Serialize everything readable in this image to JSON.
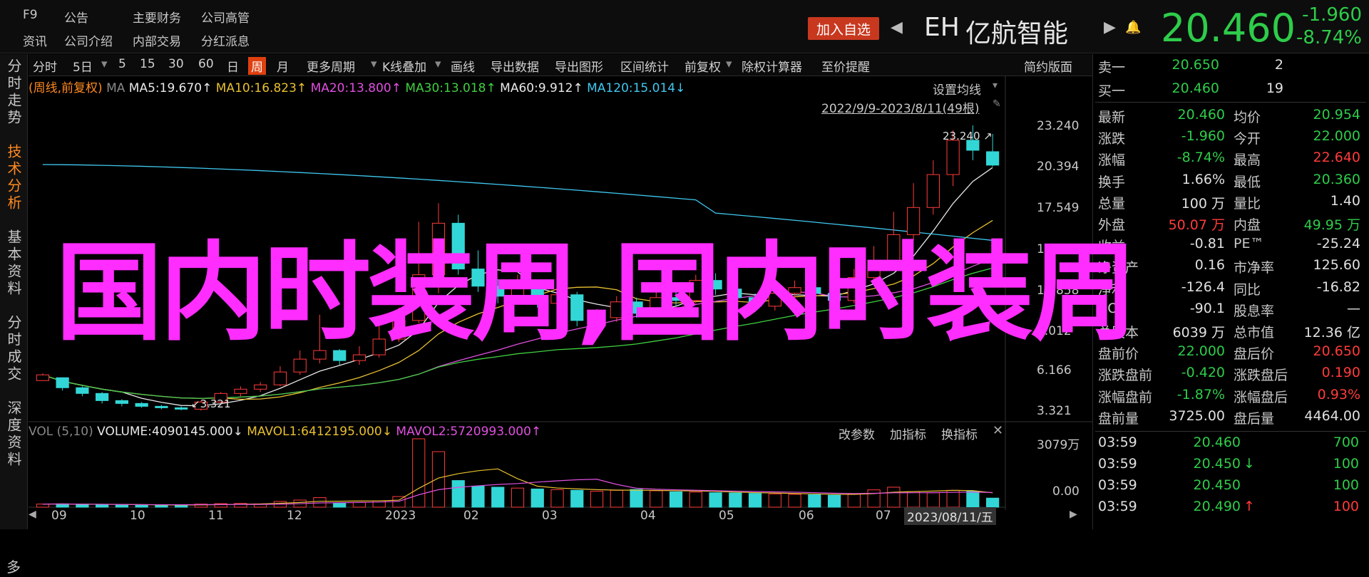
{
  "topmenu": {
    "row1": [
      "F9",
      "公告",
      "主要财务",
      "公司高管"
    ],
    "row2": [
      "资讯",
      "公司介绍",
      "内部交易",
      "分红派息"
    ]
  },
  "header": {
    "add_watch": "加入自选",
    "symbol": "EH",
    "name": "亿航智能",
    "price": "20.460",
    "change": "-1.960",
    "change_pct": "-8.74%"
  },
  "left_tabs": [
    "分时走势",
    "技术分析",
    "基本资料",
    "分时成交",
    "深度资料",
    "多"
  ],
  "toolbar": {
    "items": [
      "分时",
      "5日",
      "5",
      "15",
      "30",
      "60",
      "日",
      "周",
      "月",
      "更多周期",
      "K线叠加",
      "画线",
      "导出数据",
      "导出图形",
      "区间统计",
      "前复权",
      "除权计算器",
      "至价提醒"
    ],
    "right": "简约版面"
  },
  "ma_legend": {
    "label": "(周线,前复权)",
    "ma": "MA",
    "ma5": "MA5:19.670↑",
    "ma10": "MA10:16.823↑",
    "ma20": "MA20:13.800↑",
    "ma30": "MA30:13.018↑",
    "ma60": "MA60:9.912↑",
    "ma120": "MA120:15.014↓"
  },
  "chart_header": {
    "setting": "设置均线",
    "range": "2022/9/9-2023/8/11(49根)"
  },
  "price_axis": [
    "23.240",
    "20.394",
    "17.549",
    "14.703",
    "11.858",
    "9.012",
    "6.166",
    "3.321"
  ],
  "annotations": {
    "high": "23.240",
    "low": "3.321"
  },
  "vol_legend": {
    "vol": "VOL (5,10)",
    "volume": "VOLUME:4090145.000↓",
    "mavol1": "MAVOL1:6412195.000↓",
    "mavol2": "MAVOL2:5720993.000↑",
    "btns": [
      "改参数",
      "加指标",
      "换指标"
    ]
  },
  "vol_axis": [
    "3079万",
    "0.00"
  ],
  "x_axis": [
    "09",
    "10",
    "11",
    "12",
    "2023",
    "02",
    "03",
    "04",
    "05",
    "06",
    "07"
  ],
  "date_label": "2023/08/11/五",
  "overlay_text": "国内时装周,国内时装周",
  "order_book": [
    {
      "label": "卖一",
      "price": "20.650",
      "vol": "2"
    },
    {
      "label": "买一",
      "price": "20.460",
      "vol": "19"
    }
  ],
  "quote_rows": [
    {
      "l1": "最新",
      "v1": "20.460",
      "c1": "g",
      "l2": "均价",
      "v2": "20.954",
      "c2": "g"
    },
    {
      "l1": "涨跌",
      "v1": "-1.960",
      "c1": "g",
      "l2": "今开",
      "v2": "22.000",
      "c2": "g"
    },
    {
      "l1": "涨幅",
      "v1": "-8.74%",
      "c1": "g",
      "l2": "最高",
      "v2": "22.640",
      "c2": "red"
    },
    {
      "l1": "换手",
      "v1": "1.66%",
      "c1": "w",
      "l2": "最低",
      "v2": "20.360",
      "c2": "g"
    },
    {
      "l1": "总量",
      "v1": "100 万",
      "c1": "w",
      "l2": "量比",
      "v2": "1.40",
      "c2": "w"
    },
    {
      "l1": "外盘",
      "v1": "50.07 万",
      "c1": "red",
      "l2": "内盘",
      "v2": "49.95 万",
      "c2": "g"
    },
    {
      "l1": "收益",
      "v1": "-0.81",
      "c1": "w",
      "l2": "PE™",
      "v2": "-25.24",
      "c2": "w"
    },
    {
      "l1": "净资产",
      "v1": "0.16",
      "c1": "w",
      "l2": "市净率",
      "v2": "125.60",
      "c2": "w"
    },
    {
      "l1": "净利",
      "v1": "-126.4",
      "c1": "w",
      "l2": "同比",
      "v2": "-16.82",
      "c2": "w"
    },
    {
      "l1": "ROE",
      "v1": "-90.1",
      "c1": "w",
      "l2": "股息率",
      "v2": "—",
      "c2": "w"
    },
    {
      "l1": "总股本",
      "v1": "6039 万",
      "c1": "w",
      "l2": "总市值",
      "v2": "12.36 亿",
      "c2": "w"
    },
    {
      "l1": "盘前价",
      "v1": "22.000",
      "c1": "g",
      "l2": "盘后价",
      "v2": "20.650",
      "c2": "red"
    },
    {
      "l1": "涨跌盘前",
      "v1": "-0.420",
      "c1": "g",
      "l2": "涨跌盘后",
      "v2": "0.190",
      "c2": "red"
    },
    {
      "l1": "涨幅盘前",
      "v1": "-1.87%",
      "c1": "g",
      "l2": "涨幅盘后",
      "v2": "0.93%",
      "c2": "red"
    },
    {
      "l1": "盘前量",
      "v1": "3725.00",
      "c1": "w",
      "l2": "盘后量",
      "v2": "4464.00",
      "c2": "w"
    }
  ],
  "ticks": [
    {
      "t": "03:59",
      "p": "20.460",
      "arrow": "",
      "v": "700",
      "vc": "g"
    },
    {
      "t": "03:59",
      "p": "20.450",
      "arrow": "↓",
      "v": "100",
      "vc": "g"
    },
    {
      "t": "03:59",
      "p": "20.450",
      "arrow": "",
      "v": "100",
      "vc": "g"
    },
    {
      "t": "03:59",
      "p": "20.490",
      "arrow": "↑",
      "v": "100",
      "vc": "red"
    }
  ],
  "colors": {
    "up": "#ff3b3b",
    "down": "#2ecc4a",
    "cyan": "#33d6d6",
    "ma5": "#e8e8e8",
    "ma10": "#e8c030",
    "ma20": "#e050e0",
    "ma30": "#40d040",
    "ma60": "#e8e8e8",
    "ma120": "#40c8f0",
    "overlay": "#ff2dff"
  },
  "chart_data": {
    "type": "candlestick",
    "price_range": [
      3.321,
      23.24
    ],
    "candles": [
      [
        5.4,
        5.8,
        5.6,
        5.9
      ],
      [
        5.6,
        4.9,
        5.6,
        4.7
      ],
      [
        4.9,
        4.5,
        5.0,
        4.3
      ],
      [
        4.5,
        4.0,
        4.6,
        3.8
      ],
      [
        4.0,
        3.8,
        4.1,
        3.6
      ],
      [
        3.8,
        3.6,
        3.9,
        3.5
      ],
      [
        3.6,
        3.5,
        3.7,
        3.4
      ],
      [
        3.5,
        3.4,
        3.6,
        3.32
      ],
      [
        3.4,
        3.9,
        4.0,
        3.3
      ],
      [
        3.9,
        4.5,
        4.6,
        3.8
      ],
      [
        4.5,
        4.8,
        5.0,
        4.3
      ],
      [
        4.8,
        5.1,
        5.3,
        4.6
      ],
      [
        5.1,
        6.0,
        6.4,
        5.0
      ],
      [
        6.0,
        6.9,
        7.5,
        5.8
      ],
      [
        6.9,
        7.5,
        10.0,
        6.6
      ],
      [
        7.5,
        6.8,
        7.6,
        6.5
      ],
      [
        6.8,
        7.2,
        7.8,
        6.5
      ],
      [
        7.2,
        8.3,
        9.5,
        7.0
      ],
      [
        8.3,
        9.6,
        10.5,
        8.1
      ],
      [
        9.6,
        12.8,
        16.5,
        9.4
      ],
      [
        12.8,
        16.4,
        17.8,
        11.5
      ],
      [
        16.4,
        13.2,
        17.0,
        12.8
      ],
      [
        13.2,
        12.0,
        14.5,
        11.6
      ],
      [
        12.0,
        11.3,
        12.5,
        10.8
      ],
      [
        11.3,
        12.1,
        12.8,
        10.9
      ],
      [
        12.1,
        10.8,
        12.4,
        10.5
      ],
      [
        10.8,
        11.4,
        11.9,
        10.2
      ],
      [
        11.4,
        9.6,
        11.6,
        9.2
      ],
      [
        9.6,
        9.8,
        10.4,
        9.1
      ],
      [
        9.8,
        10.9,
        11.3,
        9.5
      ],
      [
        10.9,
        10.1,
        11.2,
        9.8
      ],
      [
        10.1,
        11.2,
        11.6,
        9.9
      ],
      [
        11.2,
        11.0,
        11.8,
        10.6
      ],
      [
        11.0,
        12.4,
        12.8,
        10.8
      ],
      [
        12.4,
        11.8,
        12.9,
        11.4
      ],
      [
        11.8,
        11.2,
        12.3,
        10.9
      ],
      [
        11.2,
        10.6,
        11.5,
        10.2
      ],
      [
        10.6,
        11.5,
        11.8,
        10.3
      ],
      [
        11.5,
        11.9,
        12.4,
        11.2
      ],
      [
        11.9,
        11.5,
        12.2,
        11.0
      ],
      [
        11.5,
        11.0,
        11.8,
        10.7
      ],
      [
        11.0,
        12.6,
        13.2,
        10.8
      ],
      [
        12.6,
        13.8,
        14.8,
        12.3
      ],
      [
        13.8,
        15.6,
        17.2,
        13.4
      ],
      [
        15.6,
        17.5,
        19.2,
        15.2
      ],
      [
        17.5,
        19.8,
        20.8,
        17.0
      ],
      [
        19.8,
        22.2,
        22.9,
        19.0
      ],
      [
        22.2,
        21.5,
        23.24,
        20.8
      ],
      [
        21.4,
        20.46,
        22.64,
        20.36
      ]
    ],
    "volume_range": [
      0,
      3079
    ],
    "volumes": [
      140,
      150,
      120,
      110,
      100,
      90,
      95,
      100,
      140,
      160,
      170,
      150,
      260,
      320,
      430,
      180,
      210,
      290,
      480,
      3079,
      2500,
      1200,
      950,
      900,
      860,
      820,
      790,
      760,
      720,
      760,
      800,
      740,
      690,
      680,
      650,
      640,
      620,
      600,
      580,
      560,
      540,
      600,
      780,
      900,
      700,
      650,
      760,
      720,
      409
    ]
  }
}
